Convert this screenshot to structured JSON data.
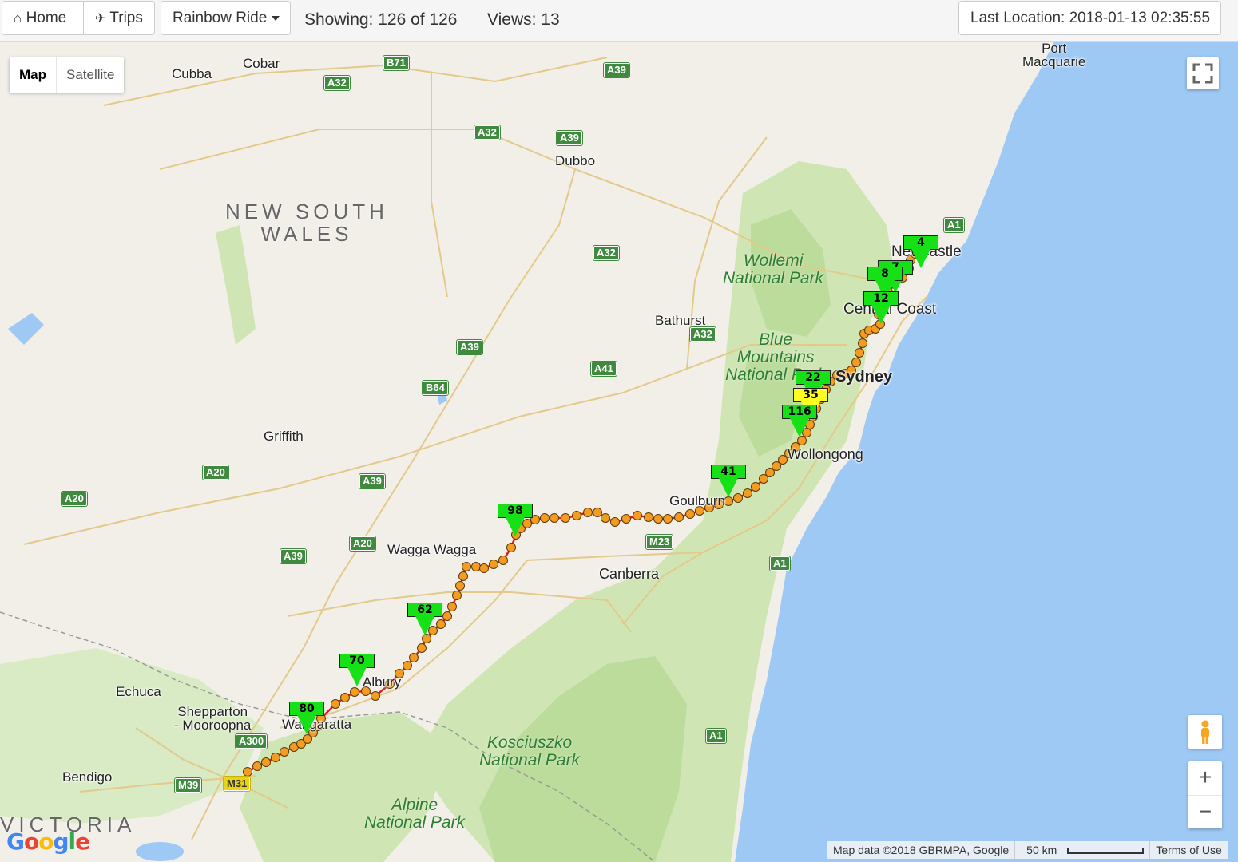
{
  "toolbar": {
    "home_label": "Home",
    "trips_label": "Trips",
    "trip_selector_label": "Rainbow Ride",
    "showing_text": "Showing: 126 of 126",
    "views_text": "Views: 13",
    "last_location_text": "Last Location: 2018-01-13 02:35:55"
  },
  "map_type": {
    "map_label": "Map",
    "satellite_label": "Satellite"
  },
  "map_labels": {
    "port_macquarie": "Port\nMacquarie",
    "cobar": "Cobar",
    "cubba": "Cubba",
    "dubbo": "Dubbo",
    "nsw": "NEW SOUTH\nWALES",
    "wollemi": "Wollemi\nNational Park",
    "newcastle": "Newcastle",
    "central_coast": "Central Coast",
    "bathurst": "Bathurst",
    "blue_mountains": "Blue\nMountains\nNational Park",
    "sydney": "Sydney",
    "griffith": "Griffith",
    "wollongong": "Wollongong",
    "goulburn": "Goulburn",
    "wagga_wagga": "Wagga Wagga",
    "canberra": "Canberra",
    "echuca": "Echuca",
    "albury": "Albury",
    "shepparton": "Shepparton\n- Mooroopna",
    "wangaratta": "Wangaratta",
    "kosciuszko": "Kosciuszko\nNational Park",
    "bendigo": "Bendigo",
    "alpine": "Alpine\nNational Park",
    "victoria": "VICTORIA"
  },
  "road_shields": [
    "B71",
    "A32",
    "A39",
    "A32",
    "A39",
    "A32",
    "A32",
    "A39",
    "A41",
    "B64",
    "A20",
    "A39",
    "A20",
    "A20",
    "A39",
    "M23",
    "A1",
    "A1",
    "A1",
    "M31",
    "M39",
    "A300"
  ],
  "markers": [
    "4",
    "7",
    "8",
    "12",
    "22",
    "35",
    "116",
    "41",
    "98",
    "62",
    "70",
    "80"
  ],
  "attribution": {
    "map_data": "Map data ©2018 GBRMPA, Google",
    "scale_label": "50 km",
    "terms": "Terms of Use"
  },
  "logo_text": "Google",
  "colors": {
    "route": "#e0201c",
    "waypoint": "#f39c1f",
    "marker_green": "#16e016",
    "marker_yellow": "#ffff22",
    "ocean": "#9ec9f5"
  }
}
